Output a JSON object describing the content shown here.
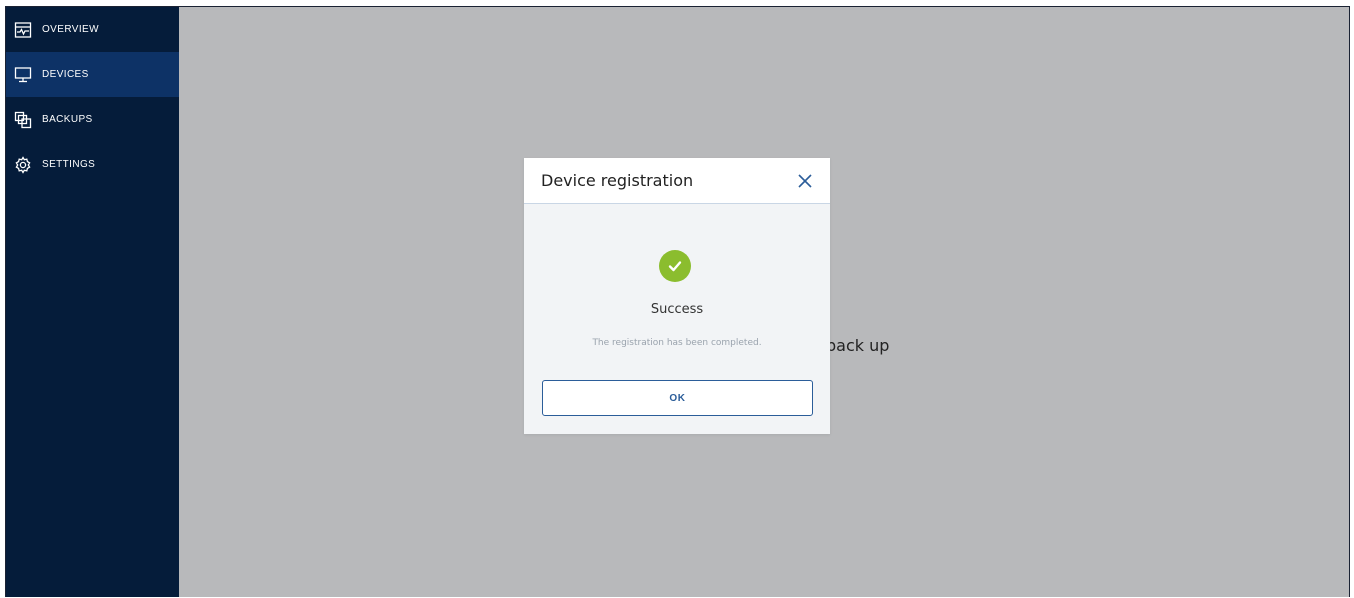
{
  "sidebar": {
    "items": [
      {
        "label": "OVERVIEW",
        "icon": "overview-icon",
        "active": false
      },
      {
        "label": "DEVICES",
        "icon": "devices-icon",
        "active": true
      },
      {
        "label": "BACKUPS",
        "icon": "backups-icon",
        "active": false
      },
      {
        "label": "SETTINGS",
        "icon": "gear-icon",
        "active": false
      }
    ]
  },
  "main": {
    "background_text": "back up"
  },
  "dialog": {
    "title": "Device registration",
    "status_title": "Success",
    "status_message": "The registration has been completed.",
    "ok_label": "OK"
  },
  "colors": {
    "sidebar_bg": "#051c3a",
    "sidebar_active": "#0d3266",
    "accent": "#2b5d99",
    "success": "#8bbd2e",
    "overlay": "#b8b9bb"
  }
}
